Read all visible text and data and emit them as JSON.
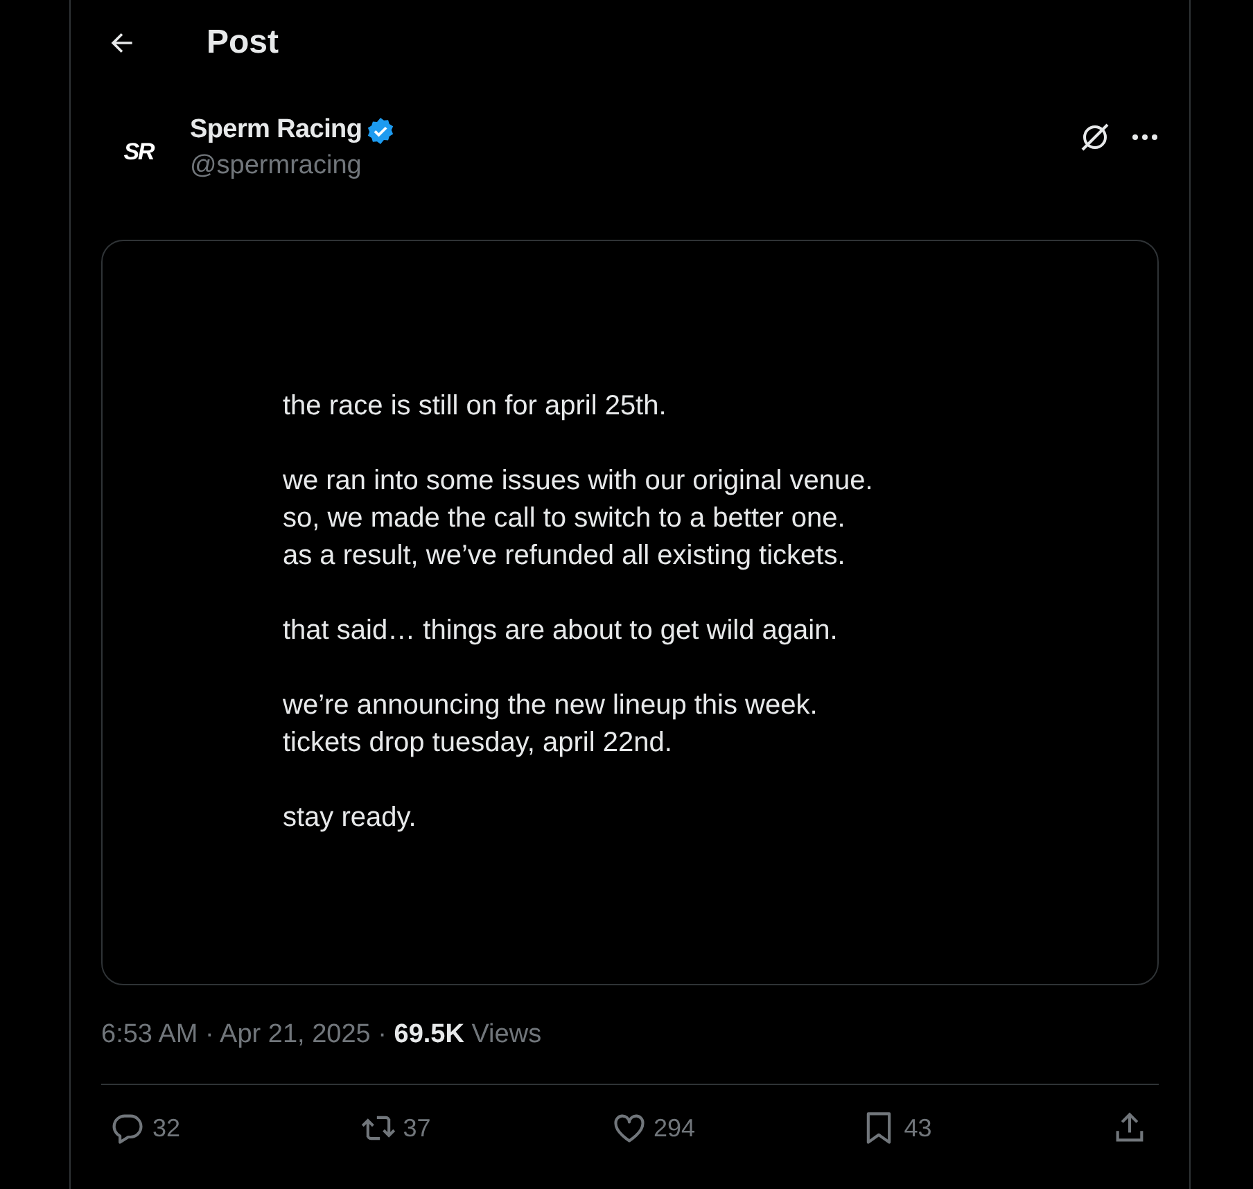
{
  "header": {
    "title": "Post"
  },
  "author": {
    "avatar_text": "SR",
    "name": "Sperm Racing",
    "verified": true,
    "handle": "@spermracing"
  },
  "media": {
    "paragraphs": [
      [
        "the race is still on for april 25th."
      ],
      [
        "we ran into some issues with our original venue.",
        "so, we made the call to switch to a better one.",
        "as a result, we’ve refunded all existing tickets."
      ],
      [
        "that said… things are about to get wild again."
      ],
      [
        "we’re announcing the new lineup this week.",
        "tickets drop tuesday, april 22nd."
      ],
      [
        "stay ready."
      ]
    ]
  },
  "meta": {
    "time": "6:53 AM",
    "separators": [
      "·",
      "·"
    ],
    "date": "Apr 21, 2025",
    "views_count": "69.5K",
    "views_label": "Views"
  },
  "actions": [
    {
      "kind": "reply",
      "count": "32"
    },
    {
      "kind": "repost",
      "count": "37"
    },
    {
      "kind": "like",
      "count": "294"
    },
    {
      "kind": "bookmark",
      "count": "43"
    },
    {
      "kind": "share"
    }
  ]
}
